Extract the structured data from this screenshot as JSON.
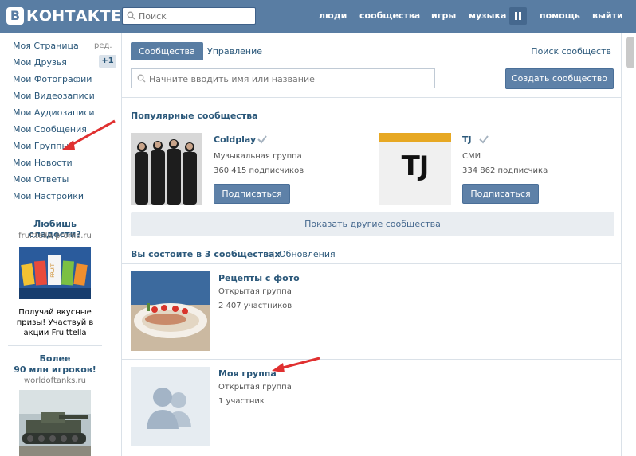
{
  "header": {
    "logo_letter": "В",
    "logo_text": "КОНТАКТЕ",
    "search_placeholder": "Поиск",
    "nav": [
      "люди",
      "сообщества",
      "игры",
      "музыка",
      "помощь",
      "выйти"
    ]
  },
  "sidebar": {
    "items": [
      {
        "label": "Моя Страница"
      },
      {
        "label": "Мои Друзья"
      },
      {
        "label": "Мои Фотографии"
      },
      {
        "label": "Мои Видеозаписи"
      },
      {
        "label": "Мои Аудиозаписи"
      },
      {
        "label": "Мои Сообщения"
      },
      {
        "label": "Мои Группы"
      },
      {
        "label": "Мои Новости"
      },
      {
        "label": "Мои Ответы"
      },
      {
        "label": "Мои Настройки"
      }
    ],
    "edit_label": "ред.",
    "friends_count": "+1",
    "ad1": {
      "title": "Любишь сладости?",
      "domain": "fruittella-promo.ru",
      "text_line1": "Получай вкусные",
      "text_line2": "призы! Участвуй в",
      "text_line3": "акции Fruittella"
    },
    "ad2": {
      "title_line1": "Более",
      "title_line2": "90 млн игроков!",
      "domain": "worldoftanks.ru"
    }
  },
  "main": {
    "tabs": {
      "active": "Сообщества",
      "manage": "Управление",
      "search_link": "Поиск сообществ"
    },
    "search_placeholder": "Начните вводить имя или название",
    "create_button": "Создать сообщество",
    "popular_title": "Популярные сообщества",
    "popular": [
      {
        "name": "Coldplay",
        "type": "Музыкальная группа",
        "followers": "360 415 подписчиков",
        "button": "Подписаться"
      },
      {
        "name": "TJ",
        "type": "СМИ",
        "followers": "334 862 подписчика",
        "button": "Подписаться",
        "logo_text": "TJ"
      }
    ],
    "show_more": "Показать другие сообщества",
    "member_title": "Вы состоите в 3 сообществах",
    "updates_link": "Обновления",
    "groups": [
      {
        "name": "Рецепты с фото",
        "type": "Открытая группа",
        "members": "2 407 участников"
      },
      {
        "name": "Моя группа",
        "type": "Открытая группа",
        "members": "1 участник"
      }
    ]
  },
  "colors": {
    "header": "#597da3",
    "link": "#2b587a",
    "button": "#5e81a8",
    "arrow": "#e03030",
    "tj_yellow": "#e7a823"
  }
}
